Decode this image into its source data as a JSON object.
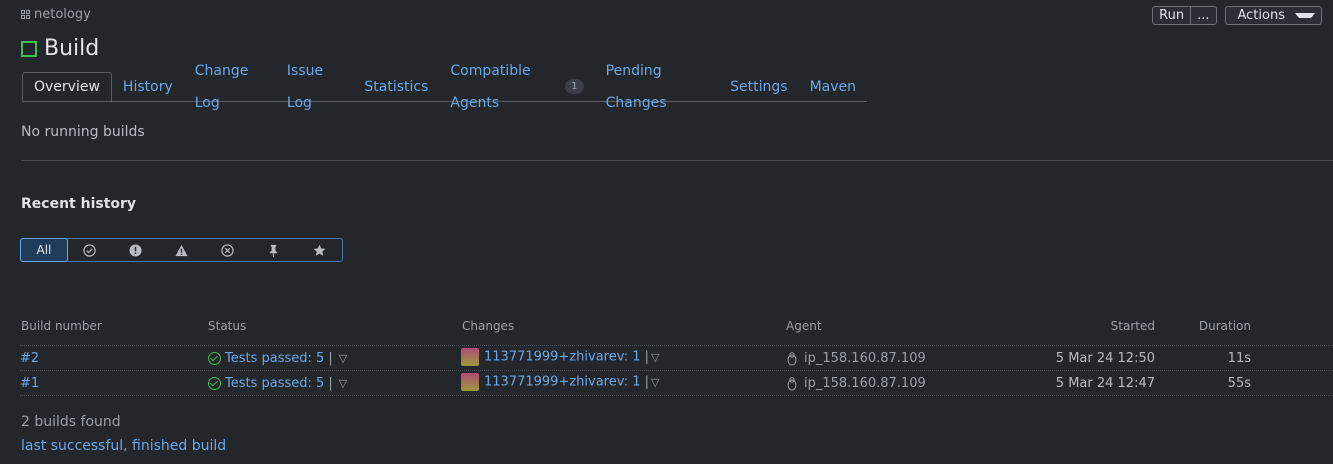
{
  "project": {
    "name": "netology",
    "icon": "grid-icon"
  },
  "top_buttons": {
    "run": "Run",
    "run_more": "...",
    "actions": "Actions"
  },
  "build": {
    "title": "Build",
    "status_color": "#3fbf55"
  },
  "tabs": [
    {
      "label": "Overview"
    },
    {
      "label": "History"
    },
    {
      "label": "Change Log"
    },
    {
      "label": "Issue Log"
    },
    {
      "label": "Statistics"
    },
    {
      "label": "Compatible Agents",
      "badge": "1"
    },
    {
      "label": "Pending Changes"
    },
    {
      "label": "Settings"
    },
    {
      "label": "Maven"
    }
  ],
  "running": {
    "text": "No running builds"
  },
  "recent": {
    "title": "Recent history"
  },
  "filters": {
    "all": "All",
    "icons": [
      "check-circle-icon",
      "exclamation-circle-icon",
      "warning-icon",
      "x-circle-icon",
      "pin-icon",
      "star-icon"
    ]
  },
  "table": {
    "headers": {
      "build_number": "Build number",
      "status": "Status",
      "changes": "Changes",
      "agent": "Agent",
      "started": "Started",
      "duration": "Duration"
    },
    "rows": [
      {
        "number": "#2",
        "status": "Tests passed: 5",
        "sep": "|",
        "changes": "113771999+zhivarev: 1",
        "agent": "ip_158.160.87.109",
        "started": "5 Mar 24 12:50",
        "duration": "11s"
      },
      {
        "number": "#1",
        "status": "Tests passed: 5",
        "sep": "|",
        "changes": "113771999+zhivarev: 1",
        "agent": "ip_158.160.87.109",
        "started": "5 Mar 24 12:47",
        "duration": "55s"
      }
    ]
  },
  "footer": {
    "count": "2 builds found",
    "link": "last successful, finished build"
  },
  "colors": {
    "accent": "#6ba8e8",
    "success": "#3fbf55",
    "background": "#23262b"
  }
}
